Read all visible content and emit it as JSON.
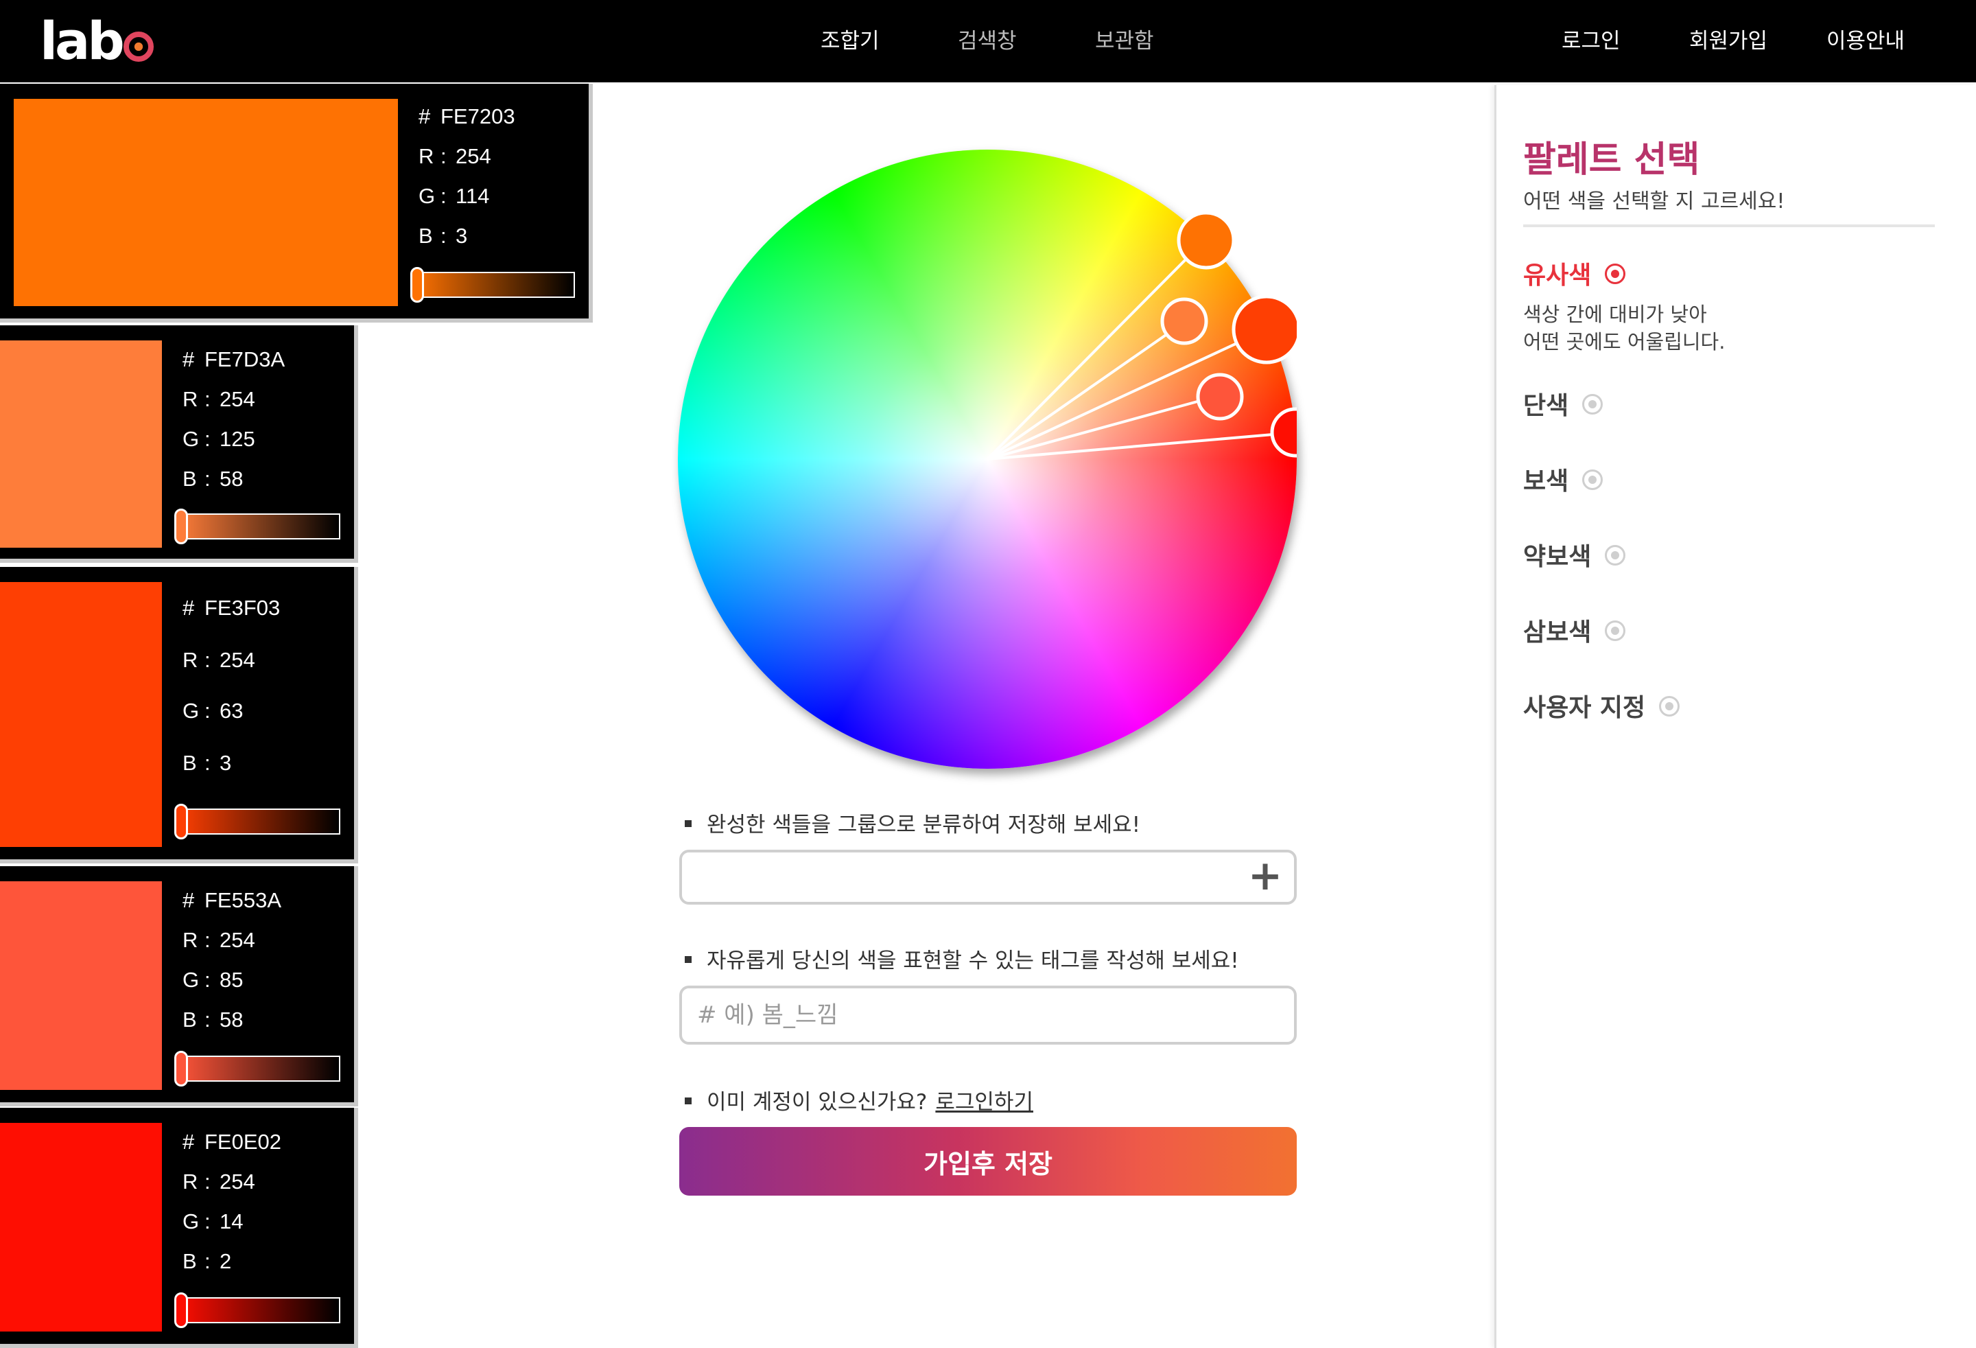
{
  "header": {
    "logo_text": "lab",
    "nav_center": [
      "조합기",
      "검색창",
      "보관함"
    ],
    "nav_right": [
      "로그인",
      "회원가입",
      "이용안내"
    ]
  },
  "colors": [
    {
      "hex_label": "#",
      "hex": "FE7203",
      "r": "254",
      "g": "114",
      "b": "3",
      "swatch": "#FE7203"
    },
    {
      "hex_label": "#",
      "hex": "FE7D3A",
      "r": "254",
      "g": "125",
      "b": "58",
      "swatch": "#FE7D3A"
    },
    {
      "hex_label": "#",
      "hex": "FE3F03",
      "r": "254",
      "g": "63",
      "b": "3",
      "swatch": "#FE3F03"
    },
    {
      "hex_label": "#",
      "hex": "FE553A",
      "r": "254",
      "g": "85",
      "b": "58",
      "swatch": "#FE553A"
    },
    {
      "hex_label": "#",
      "hex": "FE0E02",
      "r": "254",
      "g": "14",
      "b": "2",
      "swatch": "#FE0E02"
    }
  ],
  "channel_labels": {
    "r": "R",
    "g": "G",
    "b": "B",
    "sep": ":"
  },
  "main": {
    "group_hint": "완성한 색들을 그룹으로 분류하여 저장해 보세요!",
    "group_add": "+",
    "tag_hint": "자유롭게 당신의 색을 표현할 수 있는 태그를 작성해 보세요!",
    "tag_placeholder": "# 예) 봄_느낌",
    "account_hint": "이미 계정이 있으신가요?",
    "login_link": "로그인하기",
    "save_button": "가입후 저장"
  },
  "panel": {
    "title": "팔레트 선택",
    "subtitle": "어떤 색을 선택할 지 고르세요!",
    "options": [
      {
        "label": "유사색",
        "active": true
      },
      {
        "label": "단색",
        "active": false
      },
      {
        "label": "보색",
        "active": false
      },
      {
        "label": "약보색",
        "active": false
      },
      {
        "label": "삼보색",
        "active": false
      },
      {
        "label": "사용자 지정",
        "active": false
      }
    ],
    "active_desc_line1": "색상 간에 대비가 낮아",
    "active_desc_line2": "어떤 곳에도 어울립니다."
  },
  "theme": {
    "active": "#e8323c",
    "title": "#b8336a"
  }
}
